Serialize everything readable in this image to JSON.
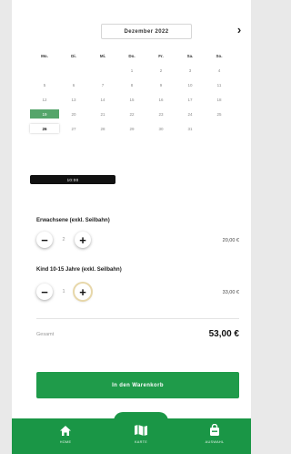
{
  "calendar": {
    "month_label": "Dezember 2022",
    "next_label": "›",
    "weekdays": [
      "Mo.",
      "Di.",
      "Mi.",
      "Do.",
      "Fr.",
      "Sa.",
      "So."
    ],
    "weeks": [
      [
        "",
        "",
        "",
        "1",
        "2",
        "3",
        "4"
      ],
      [
        "5",
        "6",
        "7",
        "8",
        "9",
        "10",
        "11"
      ],
      [
        "12",
        "13",
        "14",
        "15",
        "16",
        "17",
        "18"
      ],
      [
        "19",
        "20",
        "21",
        "22",
        "23",
        "24",
        "25"
      ],
      [
        "26",
        "27",
        "28",
        "29",
        "30",
        "31",
        ""
      ]
    ],
    "selected_day": "19",
    "highlighted_day": "26"
  },
  "time_slot": "10:00",
  "tickets": [
    {
      "label": "Erwachsene (exkl. Seilbahn)",
      "quantity": "2",
      "price": "20,00 €"
    },
    {
      "label": "Kind 10-15 Jahre (exkl. Seilbahn)",
      "quantity": "1",
      "price": "33,00 €"
    }
  ],
  "total": {
    "label": "Gesamt",
    "value": "53,00 €"
  },
  "cart_button": "In den Warenkorb",
  "nav": {
    "items": [
      {
        "label": "HOME",
        "icon": "home-icon"
      },
      {
        "label": "KARTE",
        "icon": "map-icon"
      },
      {
        "label": "AUSWAHL",
        "icon": "bag-icon"
      }
    ]
  },
  "colors": {
    "accent": "#1a9646",
    "selected_day": "#55a56a"
  }
}
